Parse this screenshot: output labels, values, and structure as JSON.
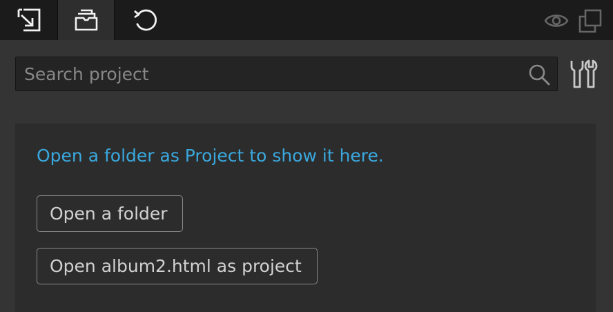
{
  "toolbar": {
    "tabs": [
      {
        "name": "import-tab",
        "icon": "import-icon"
      },
      {
        "name": "project-files-tab",
        "icon": "folder-tray-icon",
        "active": true
      },
      {
        "name": "history-tab",
        "icon": "undo-icon"
      }
    ],
    "right_icons": [
      "eye-icon",
      "windows-icon"
    ]
  },
  "search": {
    "placeholder": "Search project",
    "value": ""
  },
  "project": {
    "message": "Open a folder as Project to show it here.",
    "open_folder_label": "Open a folder",
    "open_file_label": "Open album2.html as project"
  },
  "colors": {
    "background": "#343434",
    "topbar": "#1b1b1b",
    "accent": "#3aa8de",
    "button_text": "#d2d2d2"
  }
}
